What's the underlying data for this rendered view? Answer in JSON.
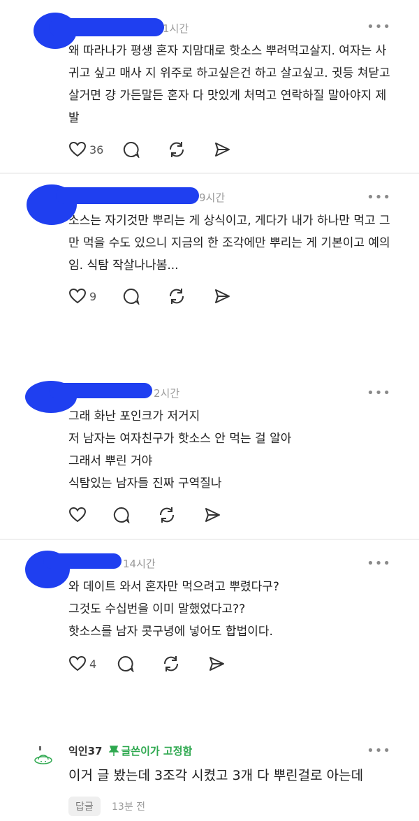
{
  "comments": [
    {
      "time": "1시간",
      "text": "왜 따라나가 평생 혼자 지맘대로 핫소스 뿌려먹고살지. 여자는 사귀고 싶고 매사 지 위주로 하고싶은건 하고 살고싶고. 귓등 쳐닫고 살거면 걍 가든말든 혼자 다 맛있게 처먹고 연락하질 말아야지 제발",
      "likes": "36"
    },
    {
      "time": "9시간",
      "text": "소스는 자기것만 뿌리는 게 상식이고, 게다가 내가 하나만 먹고 그만 먹을 수도 있으니 지금의 한 조각에만 뿌리는 게 기본이고 예의임. 식탐 작살나나봄...",
      "likes": "9"
    },
    {
      "time": "2시간",
      "lines": [
        "그래 화난 포인크가 저거지",
        "저 남자는 여자친구가 핫소스 안 먹는 걸 알아",
        "그래서 뿌린 거야",
        "식탐있는 남자들 진짜 구역질나"
      ],
      "likes": ""
    },
    {
      "time": "14시간",
      "lines": [
        "와 데이트 와서 혼자만 먹으려고 뿌렸다구?",
        "그것도 수십번을 이미 말했었다고??",
        "핫소스를 남자 콧구녕에 넣어도 합법이다."
      ],
      "likes": "4"
    }
  ],
  "more_label": "•••",
  "pinned_comment": {
    "nickname": "익인37",
    "pinned_label": "글쓴이가 고정함",
    "text": "이거 글 봤는데 3조각 시켰고 3개 다 뿌린걸로 아는데",
    "reply_label": "답글",
    "time": "13분 전"
  },
  "colors": {
    "redaction": "#1f3ff0",
    "pinned": "#2ea84f"
  }
}
